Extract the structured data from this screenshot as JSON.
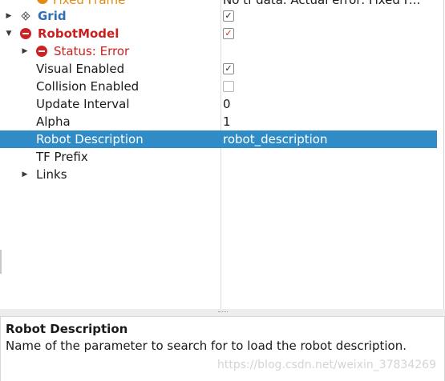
{
  "tree": {
    "rows": [
      {
        "name": "Fixed Frame",
        "value": "No tf data.  Actual error: Fixed F..."
      },
      {
        "name": "Grid",
        "value": ""
      },
      {
        "name": "RobotModel",
        "value": ""
      },
      {
        "name": "Status: Error",
        "value": ""
      },
      {
        "name": "Visual Enabled",
        "value": ""
      },
      {
        "name": "Collision Enabled",
        "value": ""
      },
      {
        "name": "Update Interval",
        "value": "0"
      },
      {
        "name": "Alpha",
        "value": "1"
      },
      {
        "name": "Robot Description",
        "value": "robot_description"
      },
      {
        "name": "TF Prefix",
        "value": ""
      },
      {
        "name": "Links",
        "value": ""
      }
    ],
    "checks": {
      "grid": "✓",
      "robotmodel": "✓",
      "visual_enabled": "✓",
      "collision_enabled": ""
    }
  },
  "description": {
    "title": "Robot Description",
    "text": "Name of the parameter to search for to load the robot description."
  },
  "watermark": "https://blog.csdn.net/weixin_37834269",
  "colors": {
    "selection": "#308cc6",
    "grid_label": "#2f6fb5",
    "robotmodel_label": "#cc1f1f",
    "status_error_label": "#cc1f1f",
    "fixed_frame_label": "#e28b16"
  }
}
